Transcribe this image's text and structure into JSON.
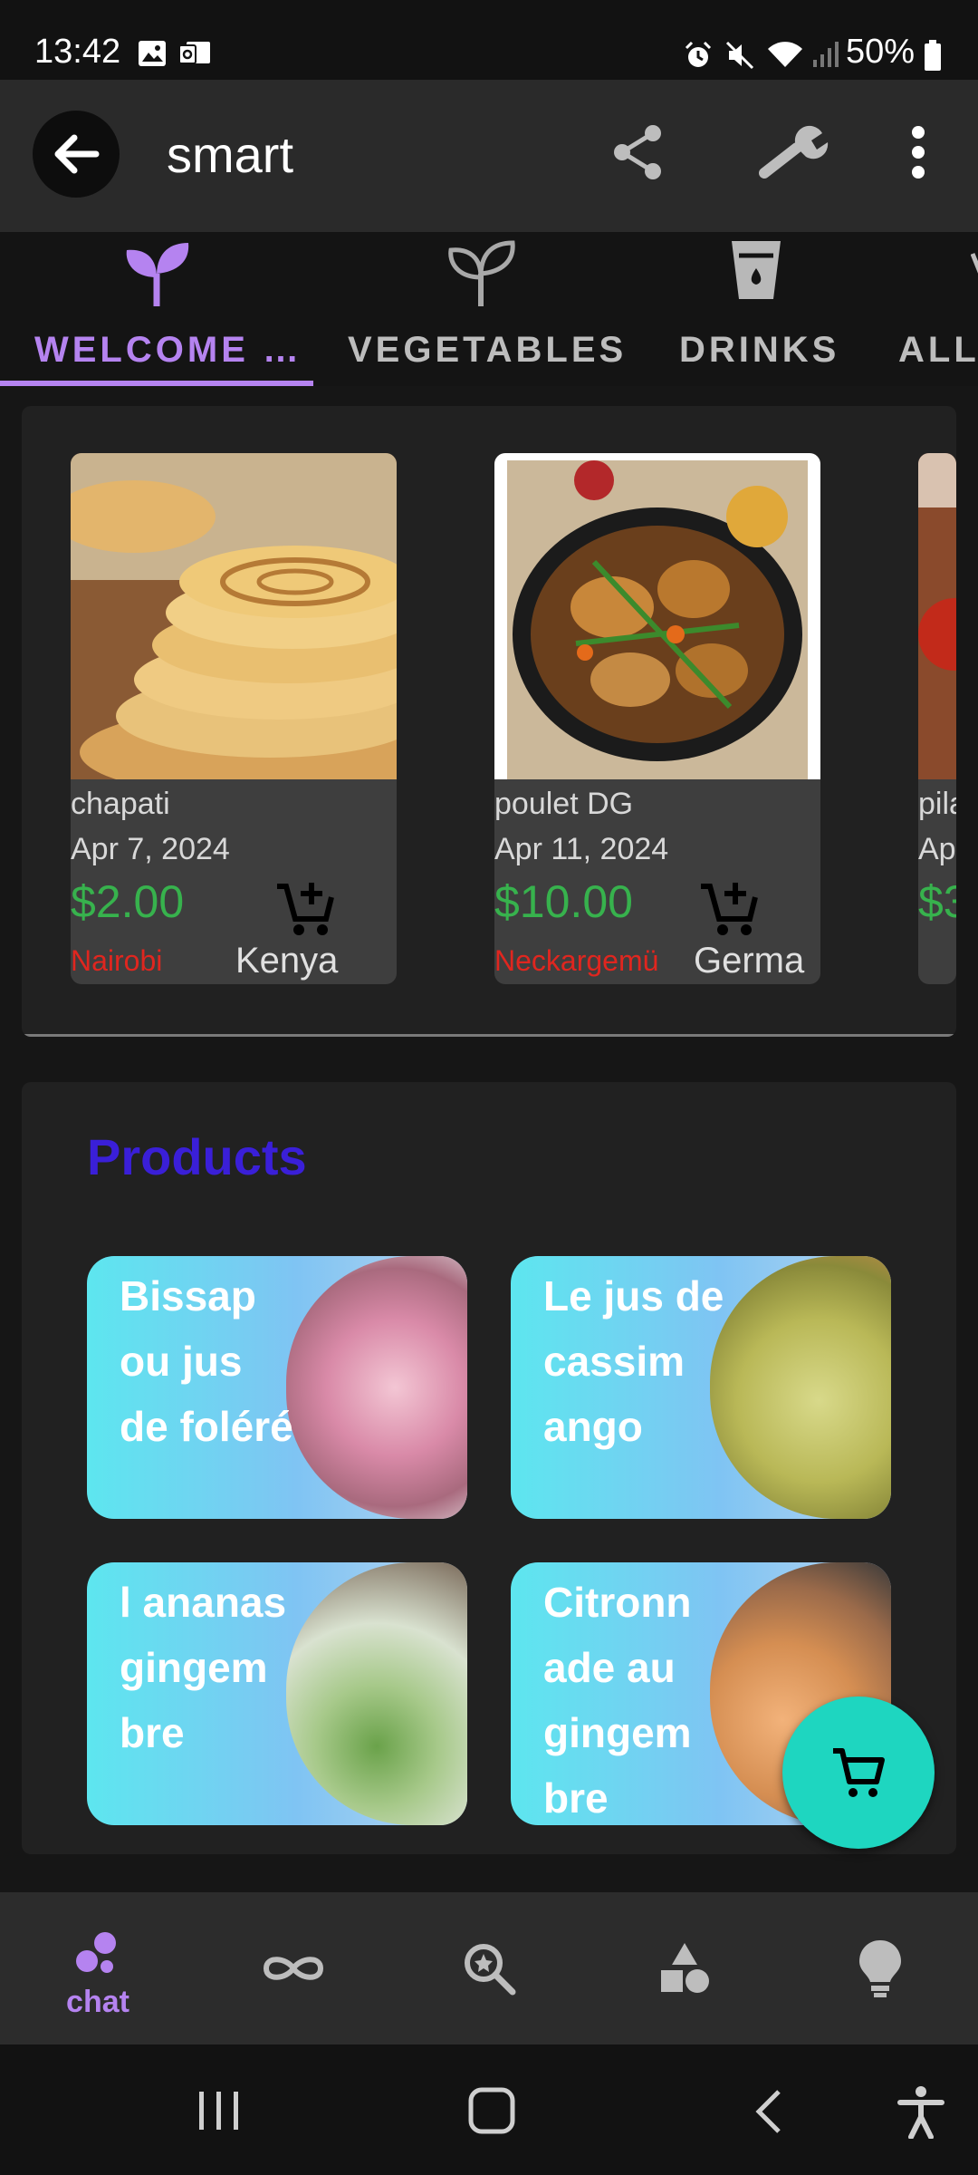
{
  "status_bar": {
    "time": "13:42",
    "battery": "50%"
  },
  "app_bar": {
    "title": "smart"
  },
  "tabs": [
    {
      "label": "WELCOME …",
      "icon": "sprout-filled-icon",
      "selected": true
    },
    {
      "label": "VEGETABLES",
      "icon": "sprout-outline-icon",
      "selected": false
    },
    {
      "label": "DRINKS",
      "icon": "glass-icon",
      "selected": false
    },
    {
      "label": "ALL",
      "icon": "chevron-icon",
      "selected": false
    }
  ],
  "featured": [
    {
      "name": "chapati",
      "date": "Apr 7, 2024",
      "price": "$2.00",
      "city": "Nairobi",
      "country": "Kenya"
    },
    {
      "name": "poulet DG",
      "date": "Apr 11, 2024",
      "price": "$10.00",
      "city": "Neckargemü",
      "country": "Germa"
    },
    {
      "name": "pila",
      "date": "Ap",
      "price": "$3",
      "city": "",
      "country": ""
    }
  ],
  "products": {
    "title": "Products",
    "items": [
      {
        "label": "Bissap ou jus de foléré"
      },
      {
        "label": "Le jus de cassim ango"
      },
      {
        "label": "l ananas gingem bre"
      },
      {
        "label": "Citronn ade au gingem bre"
      }
    ]
  },
  "bottom_nav": [
    {
      "label": "chat",
      "icon": "chat-bubbles-icon",
      "active": true
    },
    {
      "label": "",
      "icon": "infinity-icon",
      "active": false
    },
    {
      "label": "",
      "icon": "explore-search-icon",
      "active": false
    },
    {
      "label": "",
      "icon": "shapes-icon",
      "active": false
    },
    {
      "label": "",
      "icon": "lightbulb-icon",
      "active": false
    }
  ],
  "colors": {
    "accent": "#b583f0",
    "price": "#37b24d",
    "city": "#e0261f",
    "fab": "#1ed6c0",
    "products_title": "#3a1fd8"
  }
}
